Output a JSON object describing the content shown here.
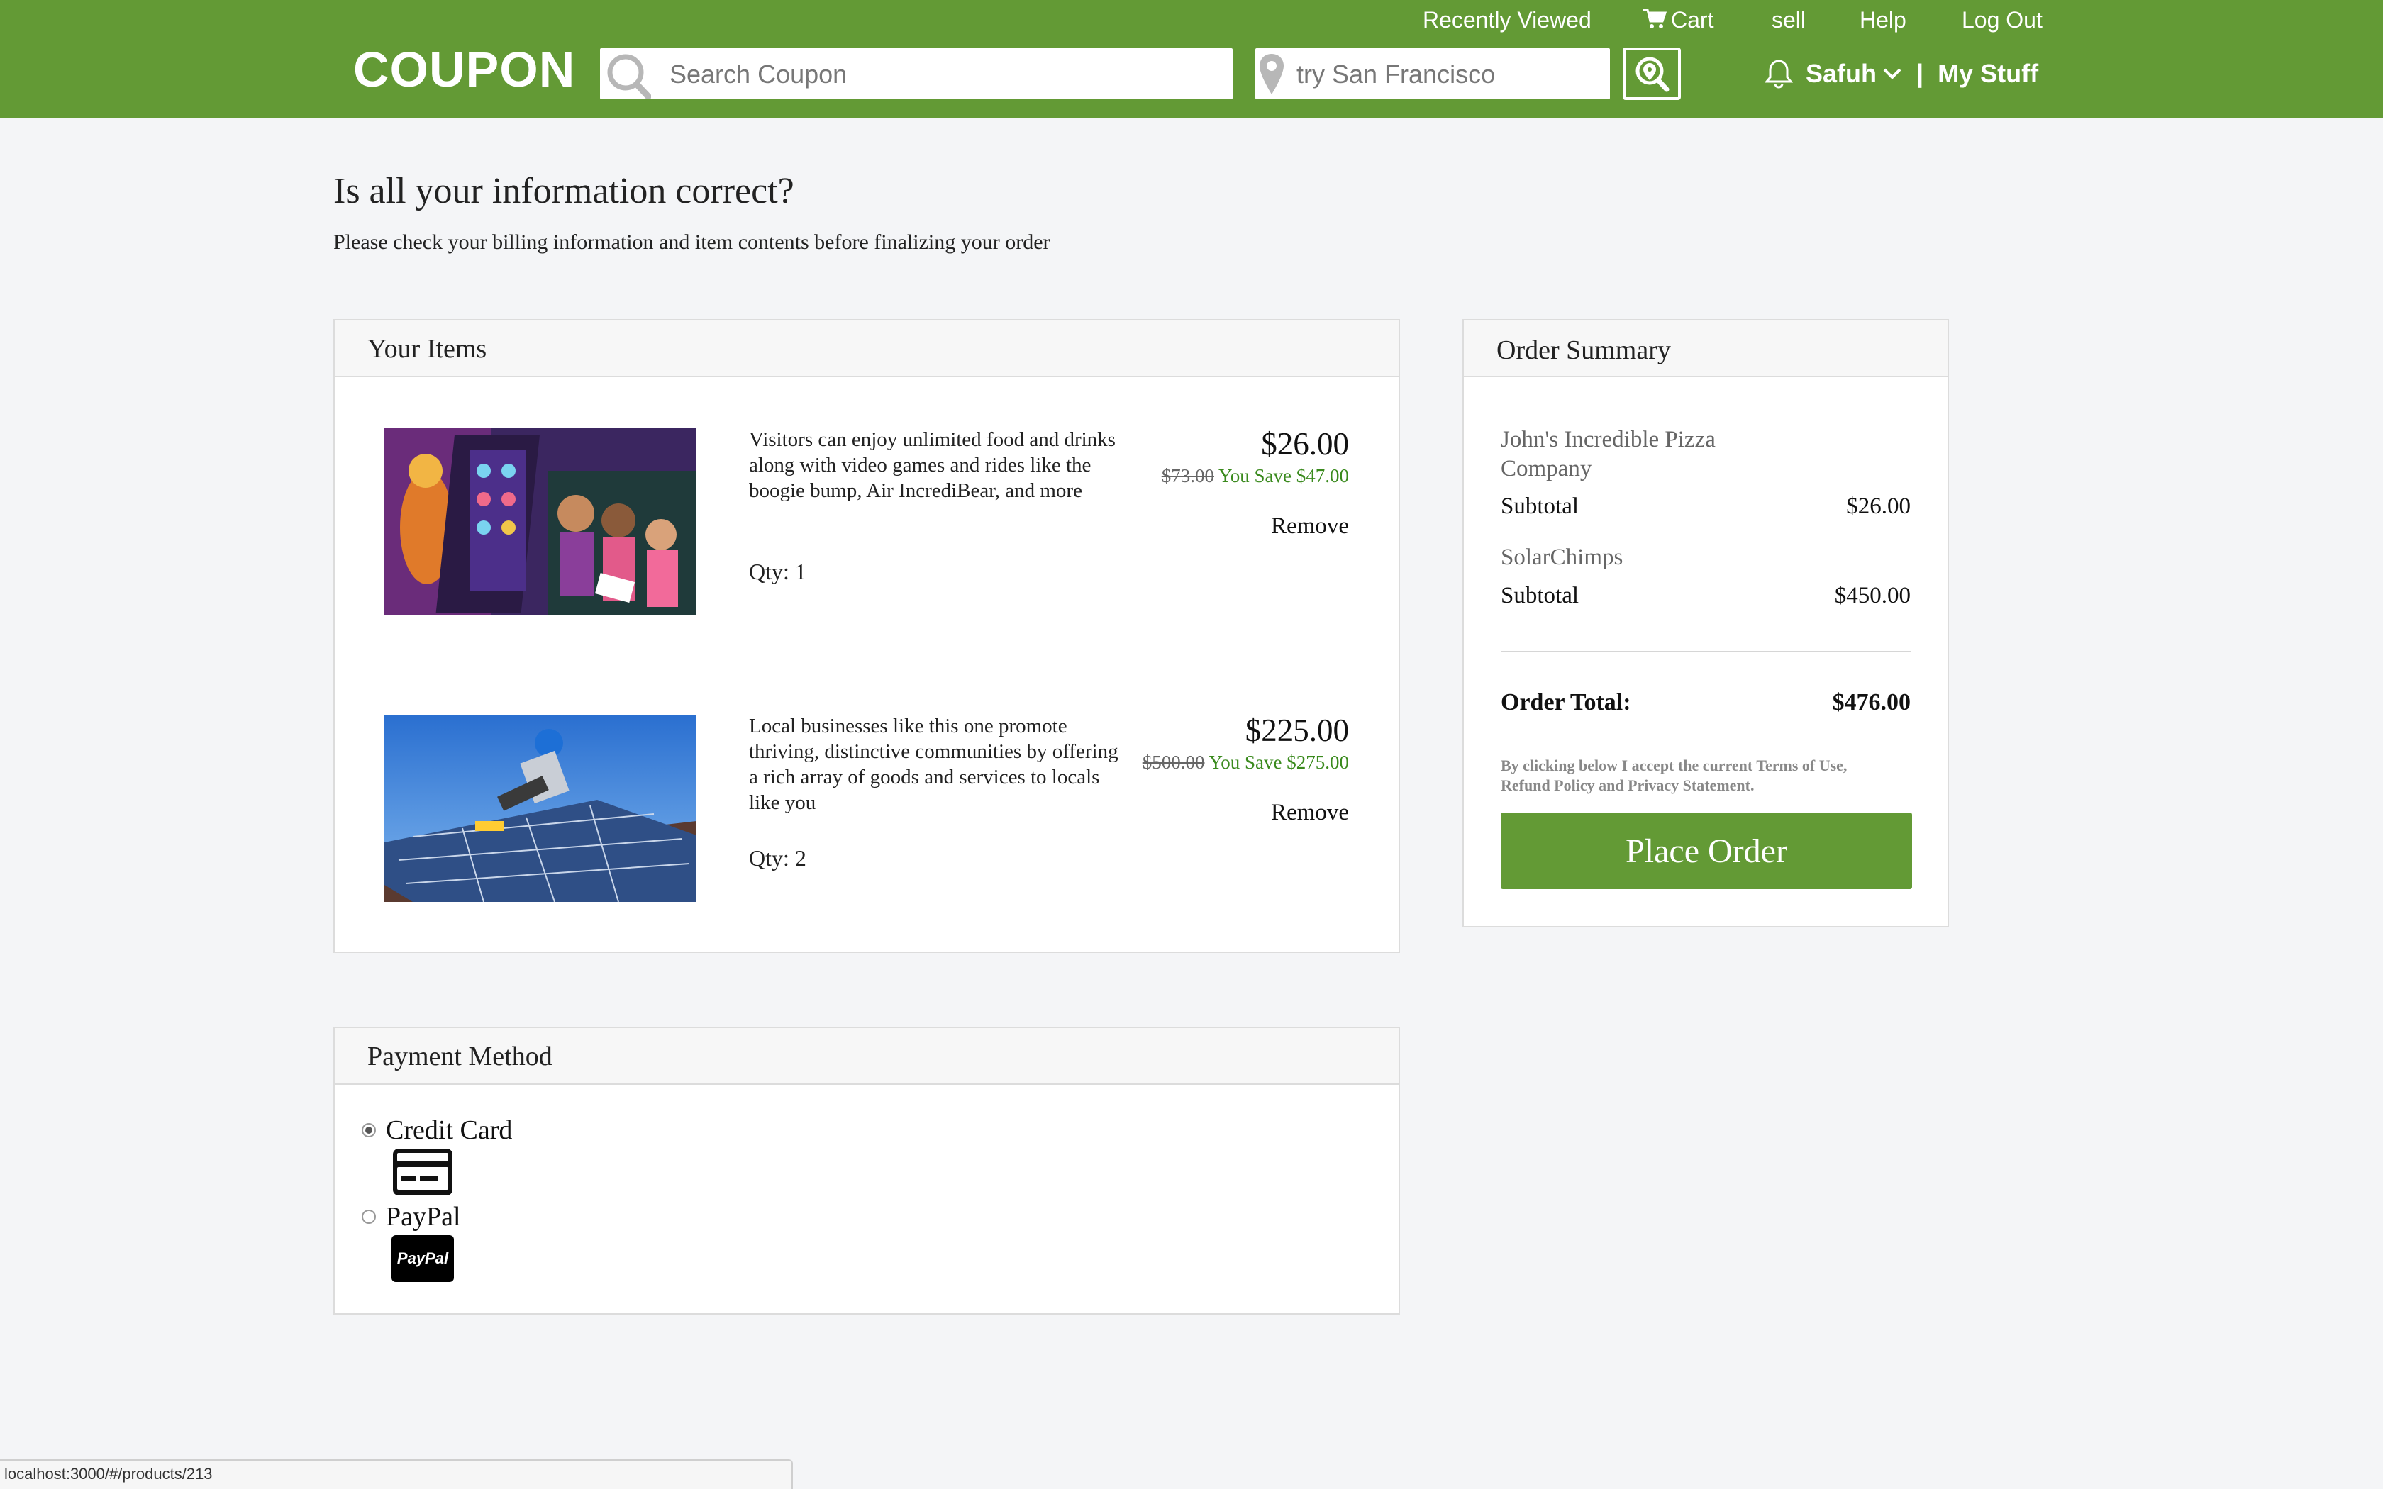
{
  "header": {
    "logo": "COUPON",
    "search_placeholder": "Search Coupon",
    "location_placeholder": "try San Francisco",
    "top_links": [
      "Recently Viewed",
      "Cart",
      "sell",
      "Help",
      "Log Out"
    ],
    "user_name": "Safuh",
    "separator": "|",
    "my_stuff": "My Stuff"
  },
  "page": {
    "title": "Is all your information correct?",
    "subtitle": "Please check your billing information and item contents before finalizing your order"
  },
  "items_panel": {
    "heading": "Your Items",
    "items": [
      {
        "description": "Visitors can enjoy unlimited food and drinks along with video games and rides like the boogie bump, Air IncrediBear, and more",
        "qty": "Qty: 1",
        "price": "$26.00",
        "original_price": "$73.00",
        "savings": "You Save $47.00",
        "remove": "Remove"
      },
      {
        "description": "Local businesses like this one promote thriving, distinctive communities by offering a rich array of goods and services to locals like you",
        "qty": "Qty: 2",
        "price": "$225.00",
        "original_price": "$500.00",
        "savings": "You Save $275.00",
        "remove": "Remove"
      }
    ]
  },
  "payment_panel": {
    "heading": "Payment Method",
    "options": [
      {
        "label": "Credit Card",
        "selected": true,
        "icon": "credit-card-icon"
      },
      {
        "label": "PayPal",
        "selected": false,
        "icon": "paypal-icon",
        "icon_text": "PayPal"
      }
    ]
  },
  "summary_panel": {
    "heading": "Order Summary",
    "merchants": [
      {
        "name": "John's Incredible Pizza Company",
        "subtotal_label": "Subtotal",
        "subtotal": "$26.00"
      },
      {
        "name": "SolarChimps",
        "subtotal_label": "Subtotal",
        "subtotal": "$450.00"
      }
    ],
    "total_label": "Order Total:",
    "total": "$476.00",
    "legal": "By clicking below I accept the current Terms of Use, Refund Policy and Privacy Statement.",
    "button": "Place Order"
  },
  "status_bar": {
    "url": "localhost:3000/#/products/213"
  },
  "colors": {
    "brand_green": "#639a35",
    "savings_green": "#3a8a1d"
  }
}
